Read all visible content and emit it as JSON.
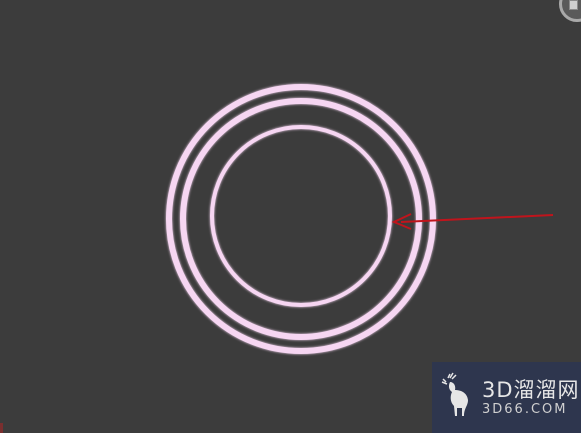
{
  "viewport": {
    "background_color": "#3c3c3c"
  },
  "shapes": {
    "ring_color": "#f6d6f2",
    "ring_glow_color": "#e7a7e2",
    "arrow_color": "#c0141c",
    "description_items": [
      "outer-ring",
      "middle-ring",
      "inner-ring"
    ]
  },
  "navigation": {
    "viewcube_icon": "viewcube-icon"
  },
  "watermark": {
    "brand": "3D溜溜网",
    "url": "3D66.COM",
    "logo_icon": "deer-icon"
  }
}
